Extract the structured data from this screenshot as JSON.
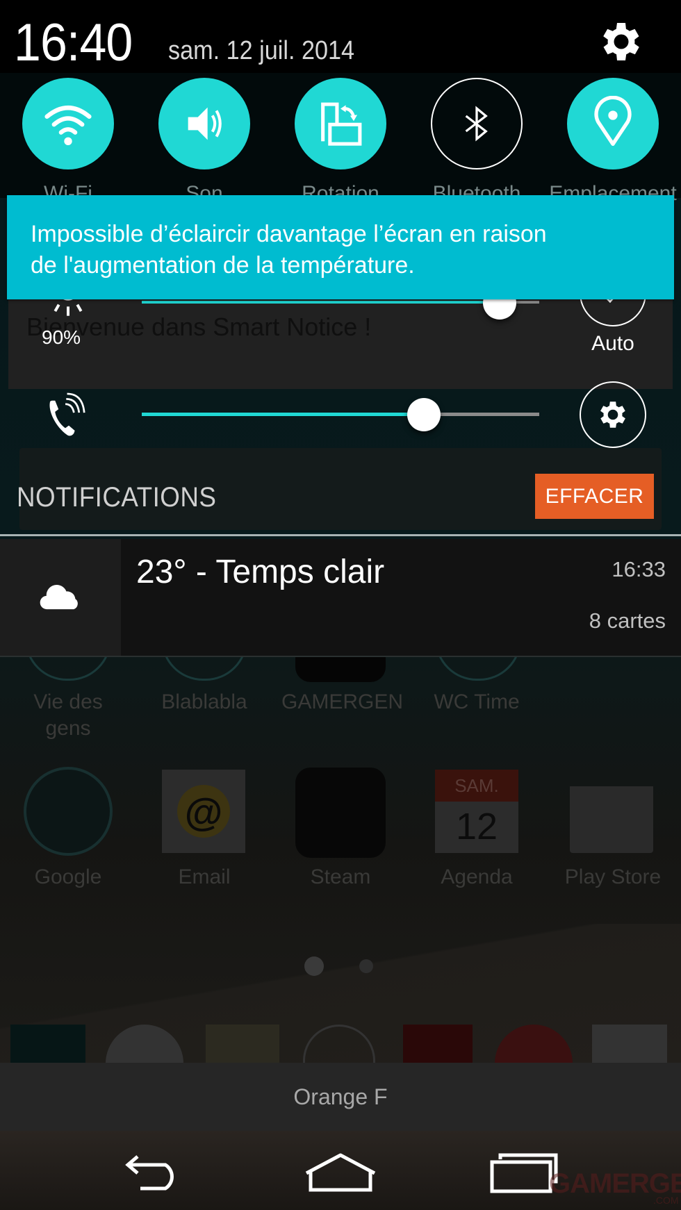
{
  "status": {
    "time": "16:40",
    "date": "sam. 12 juil. 2014"
  },
  "quick_settings": [
    {
      "id": "wifi",
      "label": "Wi-Fi",
      "icon": "wifi-icon",
      "state": "on"
    },
    {
      "id": "sound",
      "label": "Son",
      "icon": "volume-icon",
      "state": "on"
    },
    {
      "id": "rotation",
      "label": "Rotation",
      "icon": "rotation-icon",
      "state": "on"
    },
    {
      "id": "bluetooth",
      "label": "Bluetooth",
      "icon": "bluetooth-icon",
      "state": "off"
    },
    {
      "id": "location",
      "label": "Emplacement",
      "icon": "location-pin-icon",
      "state": "on"
    }
  ],
  "brightness": {
    "percent_label": "90%",
    "level": 0.9,
    "auto_label": "Auto"
  },
  "toast": {
    "message_line1": "Impossible d’éclaircir davantage l’écran en raison",
    "message_line2": "de l'augmentation de la température."
  },
  "ringer": {
    "level": 0.71
  },
  "background_widgets": {
    "smart_notice": "Bienvenue dans Smart Notice !"
  },
  "notifications": {
    "title": "NOTIFICATIONS",
    "clear_label": "EFFACER",
    "items": [
      {
        "icon": "cloud-icon",
        "title": "23° - Temps clair",
        "time": "16:33",
        "subtitle": "8 cartes"
      }
    ]
  },
  "home_apps": {
    "row1": [
      "Vie des gens",
      "Blablabla",
      "GAMERGEN",
      "WC Time"
    ],
    "row2": [
      "Google",
      "Email",
      "Steam",
      "Agenda",
      "Play Store"
    ],
    "calendar_day": "SAM.",
    "calendar_date": "12"
  },
  "carrier": "Orange F",
  "watermark": {
    "text": "GAMERGEN",
    "sub": ".COM"
  },
  "colors": {
    "accent": "#20d8d4",
    "toast": "#00bcd0",
    "clear_button": "#e55e25"
  }
}
